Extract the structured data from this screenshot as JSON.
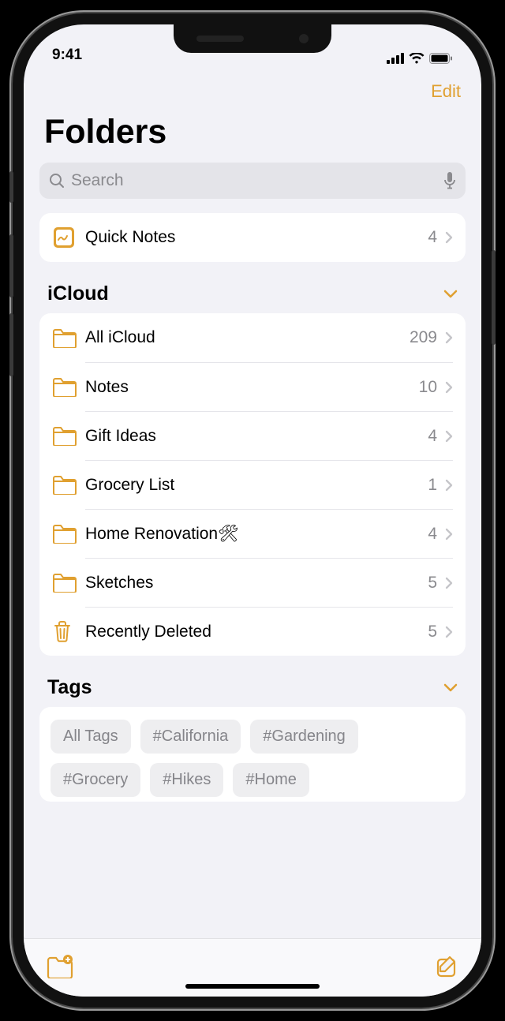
{
  "status": {
    "time": "9:41"
  },
  "nav": {
    "edit_label": "Edit"
  },
  "page": {
    "title": "Folders"
  },
  "search": {
    "placeholder": "Search"
  },
  "quick_notes": {
    "label": "Quick Notes",
    "count": "4"
  },
  "sections": {
    "icloud": {
      "title": "iCloud",
      "items": [
        {
          "label": "All iCloud",
          "count": "209",
          "icon": "folder"
        },
        {
          "label": "Notes",
          "count": "10",
          "icon": "folder"
        },
        {
          "label": "Gift Ideas",
          "count": "4",
          "icon": "folder"
        },
        {
          "label": "Grocery List",
          "count": "1",
          "icon": "folder"
        },
        {
          "label": "Home Renovation🛠",
          "count": "4",
          "icon": "folder"
        },
        {
          "label": "Sketches",
          "count": "5",
          "icon": "folder"
        },
        {
          "label": "Recently Deleted",
          "count": "5",
          "icon": "trash"
        }
      ]
    },
    "tags": {
      "title": "Tags",
      "items": [
        "All Tags",
        "#California",
        "#Gardening",
        "#Grocery",
        "#Hikes",
        "#Home"
      ]
    }
  },
  "colors": {
    "accent": "#e0a030"
  }
}
